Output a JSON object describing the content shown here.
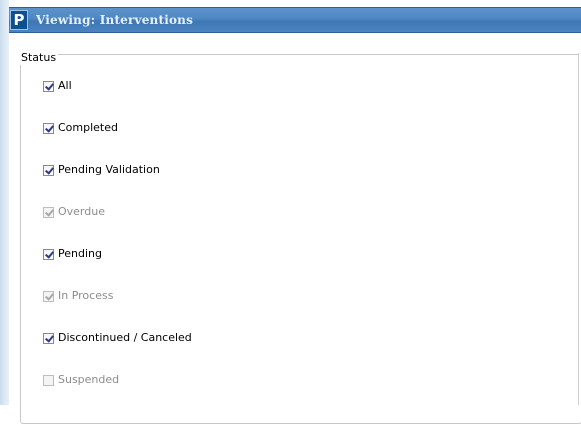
{
  "window": {
    "title": "Viewing: Interventions",
    "logo_letter": "P"
  },
  "status_group": {
    "legend": "Status",
    "items": [
      {
        "label": "All",
        "checked": true,
        "enabled": true
      },
      {
        "label": "Completed",
        "checked": true,
        "enabled": true
      },
      {
        "label": "Pending Validation",
        "checked": true,
        "enabled": true
      },
      {
        "label": "Overdue",
        "checked": true,
        "enabled": false
      },
      {
        "label": "Pending",
        "checked": true,
        "enabled": true
      },
      {
        "label": "In Process",
        "checked": true,
        "enabled": false
      },
      {
        "label": "Discontinued / Canceled",
        "checked": true,
        "enabled": true
      },
      {
        "label": "Suspended",
        "checked": false,
        "enabled": false
      }
    ]
  },
  "colors": {
    "titlebar": "#4f87c2",
    "title_text": "#e8f1fb",
    "check_mark": "#2b3a8a",
    "disabled_text": "#8d8d8d"
  }
}
